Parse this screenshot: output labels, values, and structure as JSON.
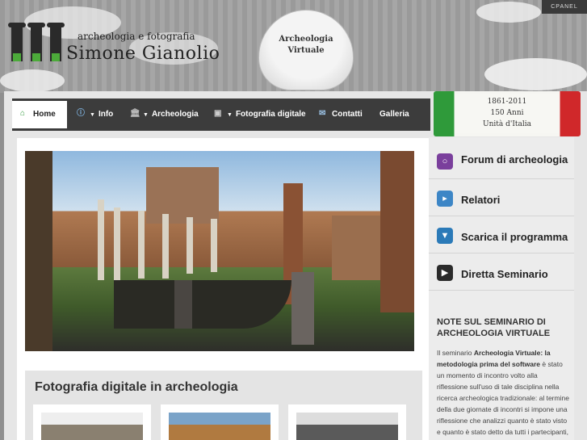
{
  "header": {
    "cpanel": "CPANEL",
    "logo_sub": "archeologia e fotografia",
    "logo_main": "Simone Gianolio",
    "balloon_line1": "Archeologia",
    "balloon_line2": "Virtuale"
  },
  "nav": {
    "items": [
      {
        "label": "Home",
        "icon": "home-icon"
      },
      {
        "label": "Info",
        "icon": "info-icon"
      },
      {
        "label": "Archeologia",
        "icon": "temple-icon"
      },
      {
        "label": "Fotografia digitale",
        "icon": "camera-icon"
      },
      {
        "label": "Contatti",
        "icon": "mail-icon"
      },
      {
        "label": "Galleria",
        "icon": ""
      }
    ]
  },
  "banner": {
    "line1": "1861-2011",
    "line2": "150 Anni",
    "line3": "Unità d'Italia"
  },
  "sidebar": {
    "items": [
      {
        "label": "Forum di archeologia",
        "icon": "forum-icon",
        "color": "#7a3f9c"
      },
      {
        "label": "Relatori",
        "icon": "megaphone-icon",
        "color": "#3d86c6"
      },
      {
        "label": "Scarica il programma",
        "icon": "download-icon",
        "color": "#2b7ab8"
      },
      {
        "label": "Diretta Seminario",
        "icon": "video-icon",
        "color": "#2b2b2b"
      }
    ],
    "note_title": "NOTE SUL SEMINARIO DI ARCHEOLOGIA VIRTUALE",
    "note_intro": "Il seminario ",
    "note_bold": "Archeologia Virtuale: la metodologia prima del software",
    "note_rest": " è stato un momento di incontro volto alla riflessione sull'uso di tale disciplina nella ricerca archeologica tradizionale: al termine della due giornate di incontri si impone una riflessione che analizzi quanto è stato visto e quanto è stato detto da tutti i partecipanti, che ringrazio per la"
  },
  "main": {
    "section_title": "Fotografia digitale in archeologia"
  },
  "colors": {
    "nav_bg": "#3c3c3c",
    "accent_green": "#2f9a3a",
    "accent_red": "#d0282a"
  }
}
